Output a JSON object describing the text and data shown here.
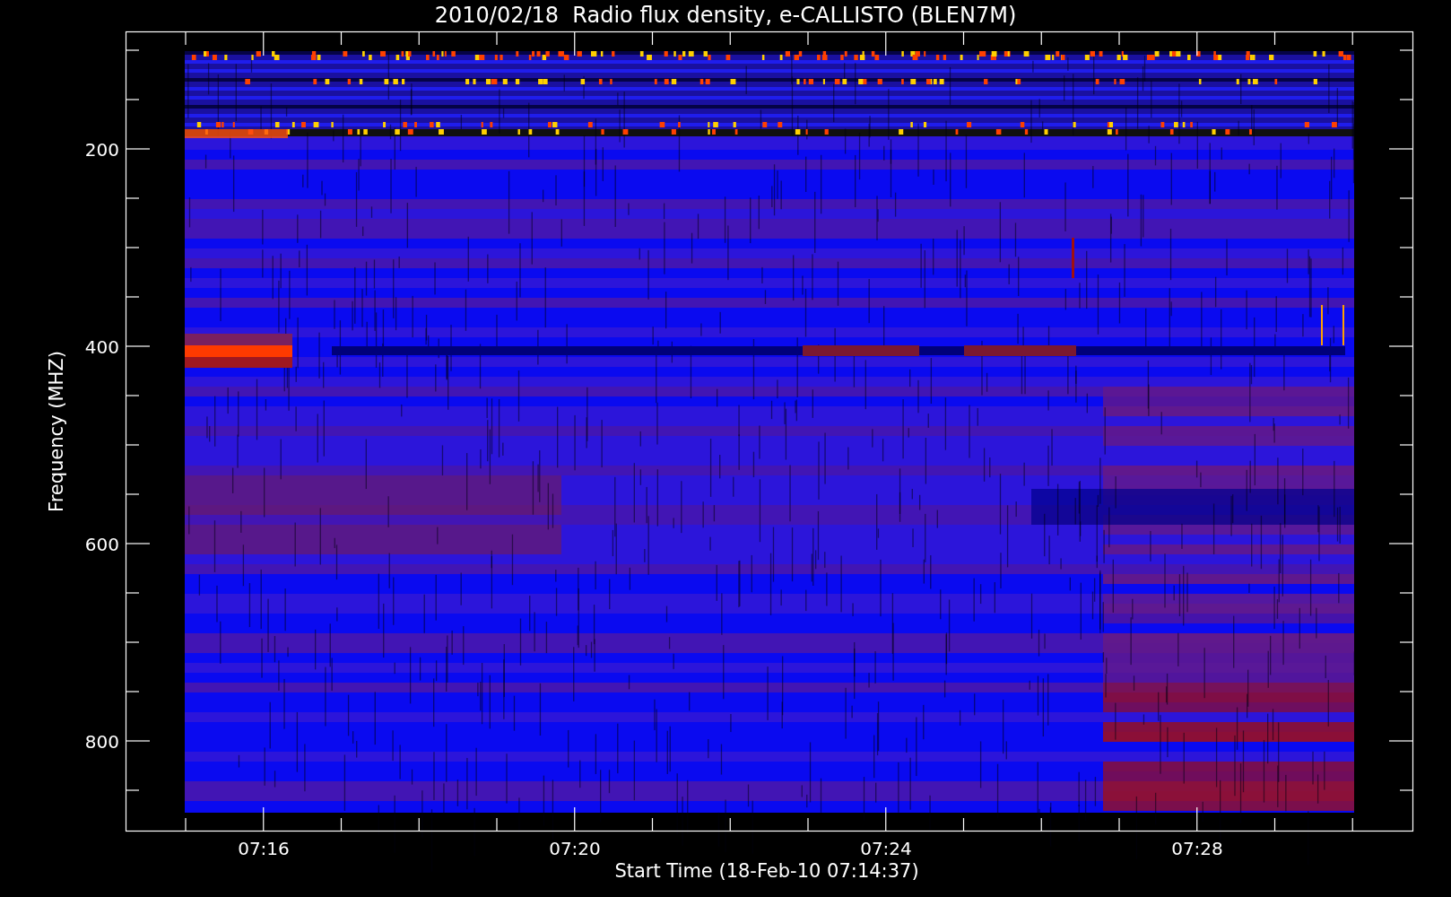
{
  "title": "2010/02/18  Radio flux density, e-CALLISTO (BLEN7M)",
  "y_axis": {
    "label": "Frequency (MHZ)",
    "ticks": [
      "200",
      "400",
      "600",
      "800"
    ]
  },
  "x_axis": {
    "label": "Start Time (18-Feb-10 07:14:37)",
    "ticks": [
      "07:16",
      "07:20",
      "07:24",
      "07:28"
    ]
  }
}
